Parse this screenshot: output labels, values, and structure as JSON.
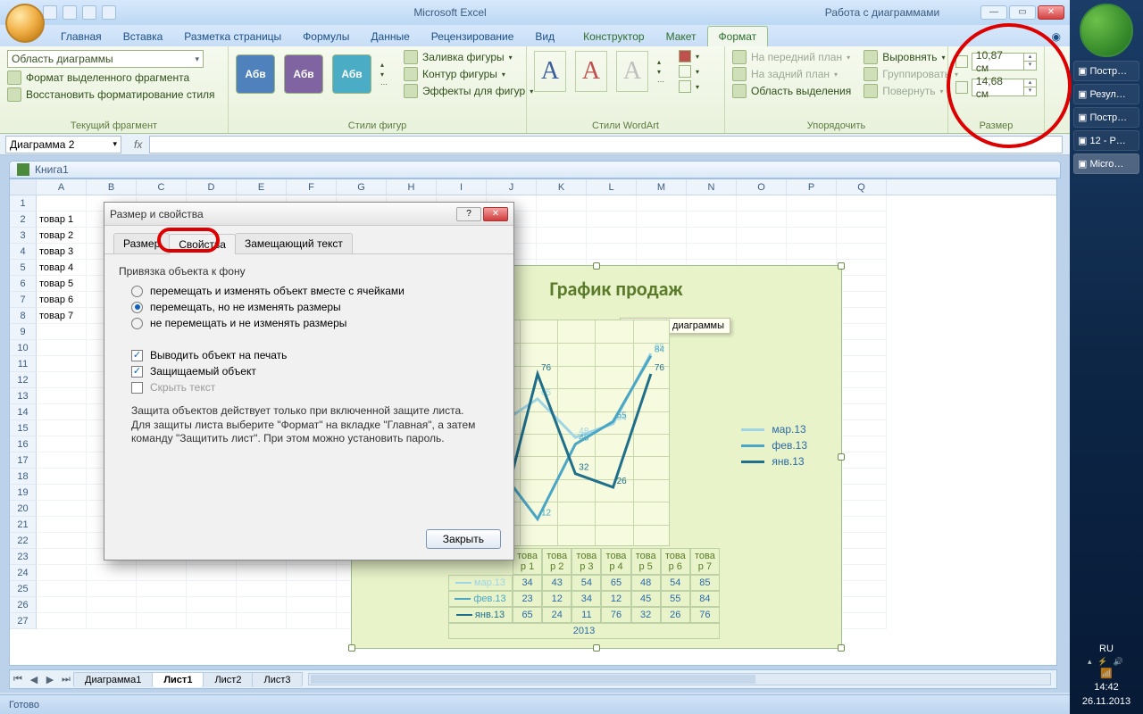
{
  "titlebar": {
    "app": "Microsoft Excel",
    "context": "Работа с диаграммами"
  },
  "tabs": [
    "Главная",
    "Вставка",
    "Разметка страницы",
    "Формулы",
    "Данные",
    "Рецензирование",
    "Вид"
  ],
  "ctx_tabs": [
    "Конструктор",
    "Макет",
    "Формат"
  ],
  "ctx_active": 2,
  "ribbon": {
    "selection": {
      "value": "Область диаграммы",
      "format_sel": "Формат выделенного фрагмента",
      "reset": "Восстановить форматирование стиля",
      "label": "Текущий фрагмент"
    },
    "shape_styles": {
      "sample": "Абв",
      "fill": "Заливка фигуры",
      "outline": "Контур фигуры",
      "effects": "Эффекты для фигур",
      "label": "Стили фигур"
    },
    "wordart": {
      "label": "Стили WordArt"
    },
    "arrange": {
      "front": "На передний план",
      "back": "На задний план",
      "pane": "Область выделения",
      "align": "Выровнять",
      "group": "Группировать",
      "rotate": "Повернуть",
      "label": "Упорядочить"
    },
    "size": {
      "h": "10,87 см",
      "w": "14,68 см",
      "label": "Размер"
    }
  },
  "namebox": "Диаграмма 2",
  "workbook_title": "Книга1",
  "columns": [
    "A",
    "B",
    "C",
    "D",
    "E",
    "F",
    "G",
    "H",
    "I",
    "J",
    "K",
    "L",
    "M",
    "N",
    "O",
    "P",
    "Q"
  ],
  "row_labels": [
    "товар 1",
    "товар 2",
    "товар 3",
    "товар 4",
    "товар 5",
    "товар 6",
    "товар 7"
  ],
  "sheets": [
    "Диаграмма1",
    "Лист1",
    "Лист2",
    "Лист3"
  ],
  "active_sheet": 1,
  "status": "Готово",
  "dialog": {
    "title": "Размер и свойства",
    "tabs": [
      "Размер",
      "Свойства",
      "Замещающий текст"
    ],
    "active_tab": 1,
    "section": "Привязка объекта к фону",
    "radios": [
      "перемещать и изменять объект вместе с ячейками",
      "перемещать, но не изменять размеры",
      "не перемещать и не изменять размеры"
    ],
    "radio_selected": 1,
    "checks": [
      {
        "label": "Выводить объект на печать",
        "checked": true
      },
      {
        "label": "Защищаемый объект",
        "checked": true
      },
      {
        "label": "Скрыть текст",
        "checked": false
      }
    ],
    "note": "Защита объектов действует только при включенной защите листа. Для защиты листа выберите \"Формат\" на вкладке \"Главная\", а затем команду \"Защитить лист\". При этом можно установить пароль.",
    "close_btn": "Закрыть"
  },
  "chart_data": {
    "type": "line",
    "title": "График продаж",
    "title_tooltip": "Название диаграммы",
    "xlabel": "2013",
    "categories": [
      "това р 1",
      "това р 2",
      "това р 3",
      "това р 4",
      "това р 5",
      "това р 6",
      "това р 7"
    ],
    "series": [
      {
        "name": "мар.13",
        "color": "#9fd5e5",
        "values": [
          34,
          43,
          54,
          65,
          48,
          54,
          85
        ]
      },
      {
        "name": "фев.13",
        "color": "#4aa6c4",
        "values": [
          23,
          12,
          34,
          12,
          45,
          55,
          84
        ]
      },
      {
        "name": "янв.13",
        "color": "#1f6f8b",
        "values": [
          65,
          24,
          11,
          76,
          32,
          26,
          76
        ]
      }
    ],
    "ylim": [
      0,
      100
    ]
  },
  "taskbar": {
    "items": [
      "Постр…",
      "Резул…",
      "Постр…",
      "12 - P…",
      "Micro…"
    ],
    "active": 4,
    "lang": "RU",
    "time": "14:42",
    "date": "26.11.2013"
  }
}
